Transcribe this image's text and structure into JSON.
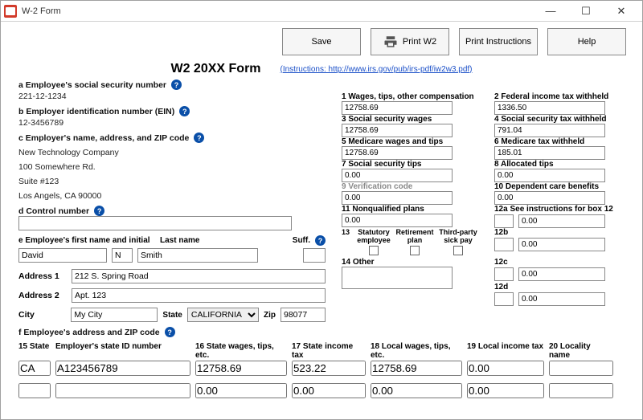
{
  "window": {
    "title": "W-2 Form"
  },
  "toolbar": {
    "save": "Save",
    "print_w2": "Print W2",
    "print_instr": "Print Instructions",
    "help": "Help"
  },
  "form": {
    "title": "W2 20XX  Form",
    "link_text": "(Instructions: http://www.irs.gov/pub/irs-pdf/iw2w3.pdf)"
  },
  "a": {
    "label": "a Employee's social security number",
    "value": "221-12-1234"
  },
  "b": {
    "label": "b Employer identification number (EIN)",
    "value": "12-3456789"
  },
  "c": {
    "label": "c Employer's name, address, and ZIP code",
    "line1": "New Technology Company",
    "line2": "100 Somewhere Rd.",
    "line3": "Suite #123",
    "line4": "Los Angels, CA 90000"
  },
  "d": {
    "label": "d Control number",
    "value": ""
  },
  "e": {
    "label_fn": "e Employee's first name and initial",
    "label_ln": "Last name",
    "label_suff": "Suff.",
    "first": "David",
    "mi": "N",
    "last": "Smith",
    "suff": ""
  },
  "addr": {
    "addr1_label": "Address 1",
    "addr1": "212 S. Spring Road",
    "addr2_label": "Address 2",
    "addr2": "Apt. 123",
    "city_label": "City",
    "city": "My City",
    "state_label": "State",
    "state": "CALIFORNIA",
    "zip_label": "Zip",
    "zip": "98077"
  },
  "f": {
    "label": "f Employee's address and ZIP code"
  },
  "boxes": {
    "b1": {
      "label": "1 Wages, tips, other compensation",
      "value": "12758.69"
    },
    "b2": {
      "label": "2 Federal income tax withheld",
      "value": "1336.50"
    },
    "b3": {
      "label": "3 Social security wages",
      "value": "12758.69"
    },
    "b4": {
      "label": "4 Social security tax withheld",
      "value": "791.04"
    },
    "b5": {
      "label": "5 Medicare wages and tips",
      "value": "12758.69"
    },
    "b6": {
      "label": "6 Medicare tax withheld",
      "value": "185.01"
    },
    "b7": {
      "label": "7 Social security tips",
      "value": "0.00"
    },
    "b8": {
      "label": "8 Allocated tips",
      "value": "0.00"
    },
    "b9": {
      "label": "9 Verification code",
      "value": "0.00"
    },
    "b10": {
      "label": "10 Dependent care benefits",
      "value": "0.00"
    },
    "b11": {
      "label": "11 Nonqualified plans",
      "value": "0.00"
    },
    "b12": {
      "label": "12a See instructions for box 12",
      "b12b": "12b",
      "b12c": "12c",
      "b12d": "12d",
      "a_c": "",
      "a_v": "0.00",
      "b_c": "",
      "b_v": "0.00",
      "c_c": "",
      "c_v": "0.00",
      "d_c": "",
      "d_v": "0.00"
    },
    "b13": {
      "label": "13",
      "s1": "Statutory employee",
      "s2": "Retirement plan",
      "s3": "Third-party sick pay"
    },
    "b14": {
      "label": "14 Other",
      "value": ""
    }
  },
  "bottom": {
    "h15": "15 State",
    "h_eid": "Employer's state ID number",
    "h16": "16 State wages, tips, etc.",
    "h17": "17 State income tax",
    "h18": "18 Local wages, tips, etc.",
    "h19": "19 Local income tax",
    "h20": "20 Locality name",
    "r1": {
      "state": "CA",
      "eid": "A123456789",
      "wages": "12758.69",
      "tax": "523.22",
      "lwages": "12758.69",
      "ltax": "0.00",
      "loc": ""
    },
    "r2": {
      "state": "",
      "eid": "",
      "wages": "0.00",
      "tax": "0.00",
      "lwages": "0.00",
      "ltax": "0.00",
      "loc": ""
    }
  }
}
